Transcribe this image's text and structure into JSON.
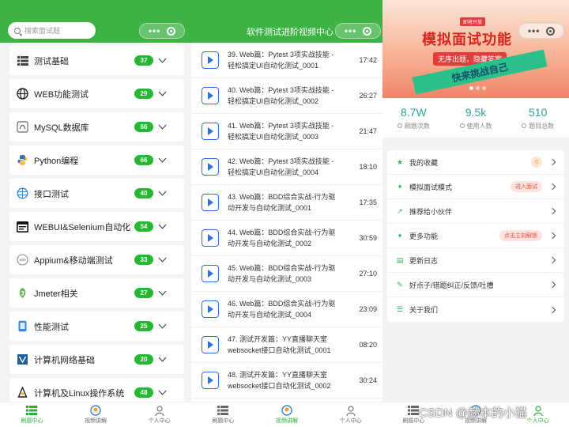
{
  "panel_left": {
    "search_placeholder": "搜索面试题",
    "categories": [
      {
        "label": "测试基础",
        "count": "37",
        "icon": "list-icon"
      },
      {
        "label": "WEB功能测试",
        "count": "29",
        "icon": "globe-icon"
      },
      {
        "label": "MySQL数据库",
        "count": "66",
        "icon": "database-icon"
      },
      {
        "label": "Python编程",
        "count": "66",
        "icon": "python-icon"
      },
      {
        "label": "接口测试",
        "count": "40",
        "icon": "network-icon"
      },
      {
        "label": "WEBUI&Selenium自动化",
        "count": "54",
        "icon": "browser-icon"
      },
      {
        "label": "Appium&移动端测试",
        "count": "33",
        "icon": "app-icon"
      },
      {
        "label": "Jmeter相关",
        "count": "27",
        "icon": "jmeter-icon"
      },
      {
        "label": "性能测试",
        "count": "25",
        "icon": "phone-icon"
      },
      {
        "label": "计算机网络基础",
        "count": "20",
        "icon": "network-doc-icon"
      },
      {
        "label": "计算机及Linux操作系统",
        "count": "48",
        "icon": "linux-icon"
      }
    ],
    "tabs": [
      {
        "label": "刷题中心",
        "active": true,
        "icon": "list-icon"
      },
      {
        "label": "视频讲解",
        "active": false,
        "icon": "video-icon"
      },
      {
        "label": "个人中心",
        "active": false,
        "icon": "person-icon"
      }
    ]
  },
  "panel_middle": {
    "title": "软件测试进阶视频中心",
    "videos": [
      {
        "title": "39. Web篇：Pytest 3项实战技能 - 轻松搞定UI自动化测试_0001",
        "duration": "17:42"
      },
      {
        "title": "40. Web篇：Pytest 3项实战技能 - 轻松搞定UI自动化测试_0002",
        "duration": "26:27"
      },
      {
        "title": "41. Web篇：Pytest 3项实战技能 - 轻松搞定UI自动化测试_0003",
        "duration": "21:47"
      },
      {
        "title": "42. Web篇：Pytest 3项实战技能 - 轻松搞定UI自动化测试_0004",
        "duration": "18:10"
      },
      {
        "title": "43. Web篇：BDD综合实战-行为驱动开发与自动化测试_0001",
        "duration": "17:35"
      },
      {
        "title": "44. Web篇：BDD综合实战-行为驱动开发与自动化测试_0002",
        "duration": "30:59"
      },
      {
        "title": "45. Web篇：BDD综合实战-行为驱动开发与自动化测试_0003",
        "duration": "27:10"
      },
      {
        "title": "46. Web篇：BDD综合实战-行为驱动开发与自动化测试_0004",
        "duration": "23:09"
      },
      {
        "title": "47. 测试开发篇：YY直播聊天室websocket接口自动化测试_0001",
        "duration": "08:20"
      },
      {
        "title": "48. 测试开发篇：YY直播聊天室websocket接口自动化测试_0002",
        "duration": "30:24"
      }
    ],
    "tabs": [
      {
        "label": "刷题中心",
        "active": false
      },
      {
        "label": "视频讲解",
        "active": true
      },
      {
        "label": "个人中心",
        "active": false
      }
    ]
  },
  "panel_right": {
    "banner": {
      "tag": "即将开放",
      "headline": "模拟面试功能",
      "subline": "无序出题，隐藏答案",
      "ribbon": "快来挑战自己"
    },
    "stats": [
      {
        "value": "8.7W",
        "label": "刷题次数"
      },
      {
        "value": "9.5k",
        "label": "使用人数"
      },
      {
        "value": "510",
        "label": "题目总数"
      }
    ],
    "menu": [
      {
        "label": "我的收藏",
        "icon": "star-icon",
        "count": "0"
      },
      {
        "label": "模拟面试模式",
        "icon": "magic-icon",
        "pill": "进入面试"
      },
      {
        "label": "推荐给小伙伴",
        "icon": "share-icon"
      },
      {
        "label": "更多功能",
        "icon": "magic-icon",
        "pill": "点击立刻解锁"
      },
      {
        "label": "更新日志",
        "icon": "log-icon"
      },
      {
        "label": "好点子/错题纠正/反馈/吐槽",
        "icon": "edit-icon"
      },
      {
        "label": "关于我们",
        "icon": "info-icon"
      }
    ],
    "tabs": [
      {
        "label": "刷题中心",
        "active": false
      },
      {
        "label": "视频讲解",
        "active": false
      },
      {
        "label": "个人中心",
        "active": true
      }
    ]
  },
  "watermark": "CSDN @赫本的小猫",
  "colors": {
    "primary_green": "#3db345",
    "badge_green": "#26b833",
    "accent_teal": "#2aa3a0",
    "play_blue": "#2f6fe0",
    "pill_red": "#e0513d"
  }
}
